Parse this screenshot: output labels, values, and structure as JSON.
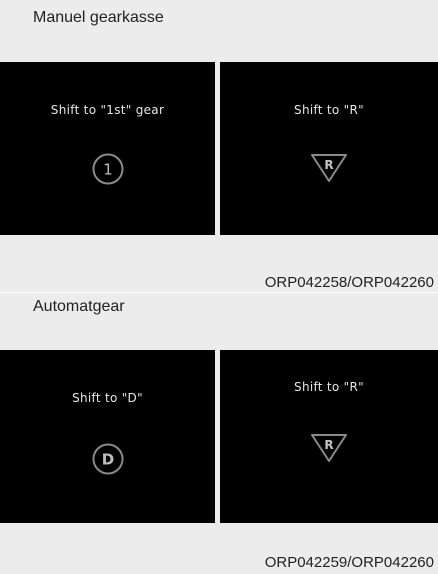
{
  "manual": {
    "title": "Manuel gearkasse",
    "panel_left_text": "Shift to \"1st\" gear",
    "panel_left_glyph": "1",
    "panel_right_text": "Shift to \"R\"",
    "panel_right_glyph": "R",
    "caption": "ORP042258/ORP042260"
  },
  "automatic": {
    "title": "Automatgear",
    "panel_left_text": "Shift to \"D\"",
    "panel_left_glyph": "D",
    "panel_right_text": "Shift to \"R\"",
    "panel_right_glyph": "R",
    "caption": "ORP042259/ORP042260"
  },
  "icons": {
    "circle_gear": "circled-gear-number-icon",
    "reverse_triangle": "reverse-triangle-icon"
  }
}
